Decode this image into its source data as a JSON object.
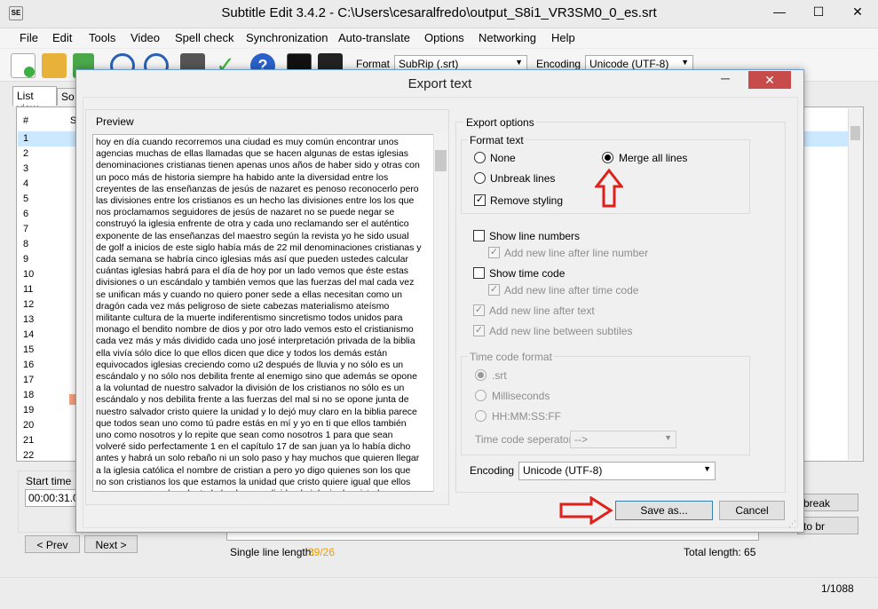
{
  "window": {
    "app_icon": "SE",
    "title": "Subtitle Edit 3.4.2 - C:\\Users\\cesaralfredo\\output_S8i1_VR3SM0_0_es.srt",
    "min": "—",
    "max": "☐",
    "close": "✕"
  },
  "menu": [
    "File",
    "Edit",
    "Tools",
    "Video",
    "Spell check",
    "Synchronization",
    "Auto-translate",
    "Options",
    "Networking",
    "Help"
  ],
  "toolbar": {
    "format_label": "Format",
    "format_value": "SubRip (.srt)",
    "encoding_label": "Encoding",
    "encoding_value": "Unicode (UTF-8)"
  },
  "tabs": {
    "list_view": "List view",
    "source_view": "So"
  },
  "list": {
    "header_num": "#",
    "header_s": "S",
    "rows": [
      "1",
      "2",
      "3",
      "4",
      "5",
      "6",
      "7",
      "8",
      "9",
      "10",
      "11",
      "12",
      "13",
      "14",
      "15",
      "16",
      "17",
      "18",
      "19",
      "20",
      "21",
      "22"
    ]
  },
  "bottom": {
    "start_time_label": "Start time",
    "start_time_value": "00:00:31.0",
    "prev": "< Prev",
    "next": "Next >",
    "break_btn": "break",
    "to_br_btn": "to br",
    "single_line_label": "Single line length:",
    "single_line_value": "39/26",
    "total_length": "Total length: 65"
  },
  "status": {
    "count": "1/1088"
  },
  "dialog": {
    "title": "Export text",
    "preview_label": "Preview",
    "preview_text": "hoy en día cuando recorremos una ciudad es muy común encontrar unos agencias muchas de ellas llamadas que se hacen algunas de estas iglesias denominaciones cristianas tienen apenas unos años de haber sido y otras con un poco más de historia siempre ha habido ante la diversidad entre los creyentes de las enseñanzas de jesús de nazaret es penoso reconocerlo pero las divisiones entre los cristianos es un hecho las divisiones entre los los que nos proclamamos seguidores de jesús de nazaret no se puede negar se construyó la iglesia enfrente de otra y cada uno reclamando ser el auténtico exponente de las enseñanzas del maestro según la revista yo he sido usual de golf a inicios de este siglo había más de 22 mil denominaciones cristianas y cada semana se habría cinco iglesias más así que pueden ustedes calcular cuántas iglesias habrá para el día de hoy por un lado vemos que éste estas divisiones o un escándalo y también vemos que las fuerzas del mal cada vez se unifican más y cuando no quiero poner sede a ellas necesitan como un dragón cada vez más peligroso de siete cabezas materialismo ateísmo militante cultura de la muerte indiferentismo sincretismo todos unidos para monago el bendito nombre de dios y por otro lado vemos esto el cristianismo cada vez más y más dividido cada uno josé interpretación privada de la biblia ella vivía sólo dice lo que ellos dicen que dice y todos los demás están equivocados iglesias creciendo como u2 después de lluvia y no sólo es un escándalo y no sólo nos debilita frente al enemigo sino que además se opone a la voluntad de nuestro salvador la división de los cristianos no sólo es un escándalo y nos debilita frente a las fuerzas del mal si no se opone junta de nuestro salvador cristo quiere la unidad y lo dejó muy claro en la biblia parece que todos sean uno como tú padre estás en mí y yo en ti que ellos también uno como nosotros y lo repite que sean como nosotros 1 para que sean volveré sido perfectamente 1 en el capítulo 17 de san juan ya lo había dicho antes y habrá un solo rebaño ni un solo paso y hay muchos que quieren llegar a la iglesia católica el nombre de cristian a pero yo digo quienes son los que no son cristianos los que estamos la unidad que cristo quiere igual que ellos que se oponen a la voluntad el sr los que dividen la iglesia de cristo los que",
    "export_options_label": "Export options",
    "format_text_label": "Format text",
    "opt_none": "None",
    "opt_merge": "Merge all lines",
    "opt_unbreak": "Unbreak lines",
    "opt_remove_styling": "Remove styling",
    "show_line_numbers": "Show line numbers",
    "add_new_line_after_line_number": "Add new line after line number",
    "show_time_code": "Show time code",
    "add_new_line_after_time_code": "Add new line after time code",
    "add_new_line_after_text": "Add new line after text",
    "add_new_line_between_subtitles": "Add new line between subtiles",
    "time_code_format_label": "Time code format",
    "tc_srt": ".srt",
    "tc_ms": "Milliseconds",
    "tc_hhmmssff": "HH:MM:SS:FF",
    "tc_separator_label": "Time code seperator",
    "tc_separator_value": "-->",
    "encoding_label": "Encoding",
    "encoding_value": "Unicode (UTF-8)",
    "save_as": "Save as...",
    "cancel": "Cancel",
    "close": "✕",
    "min": "─"
  },
  "colors": {
    "accent_red": "#e0201b",
    "selection": "#cce8ff",
    "dialog_close": "#c74b4b",
    "length_orange": "#e8a000"
  }
}
